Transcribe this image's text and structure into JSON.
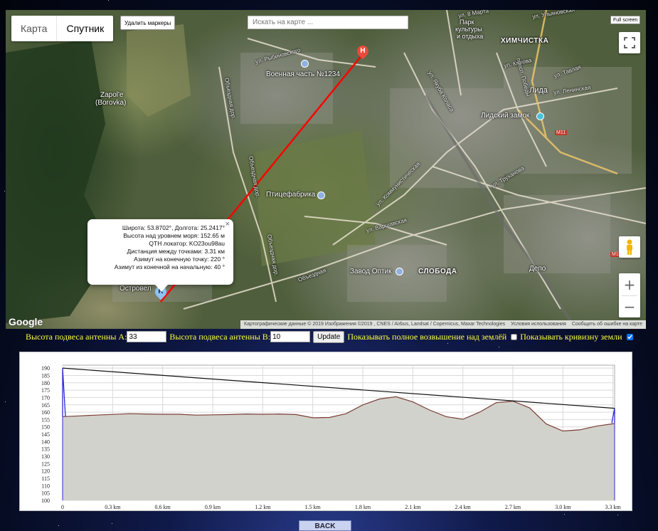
{
  "map": {
    "type_toggle": {
      "map_label": "Карта",
      "satellite_label": "Спутник",
      "selected": "Спутник"
    },
    "remove_markers_label": "Удалить маркеры",
    "search_placeholder": "Искать на карте ...",
    "fullscreen_label": "Full screen",
    "labels": {
      "military": "Военная часть №1234",
      "zapolle": "Zapol'e",
      "borovka": "(Borovka)",
      "khimchistka": "ХИМЧИСТКА",
      "park1": "Парк",
      "park2": "культуры",
      "park3": "и отдыха",
      "lida": "Лида",
      "castle": "Лидский замок",
      "poultry": "Птицефабрика",
      "optic": "Завод Оптик",
      "sloboda": "СЛОБОДА",
      "depot": "Депо",
      "ostrovel": "Островел",
      "st_rybinovskogo": "ул. Рыбиновского",
      "st_kirova": "ул. Кирова",
      "st_leninskaya": "ул. Ленинская",
      "st_tavlaya": "ул. Тавлая",
      "st_varshavskaya": "ул. Варшавская",
      "st_kommunisticheskaya": "ул. Коммунистическая",
      "st_truhanova": "ул. Труханова",
      "st_yakuba_kolasa": "ул. Якуба Коласа",
      "road_obezdnaya1": "Объездная дор.",
      "road_obezdnaya2": "Объездная",
      "pr_pobedy": "просп. Победы",
      "m11": "M11",
      "st_marta": "ул. 8 Марта",
      "st_ulyanovskaya": "ул. Ульяновская"
    },
    "markers": {
      "a": "K",
      "b": "H"
    },
    "google_label": "Google",
    "attribution": "Картографические данные © 2019 Изображения ©2019 , CNES / Airbus, Landsat / Copernicus, Maxar Technologies",
    "terms": "Условия использования",
    "report": "Сообщить об ошибке на карте",
    "infowindow": {
      "close": "×",
      "lines": [
        "Широта: 53.8702°, Долгота: 25.2417°",
        "Высота над уровнем моря: 152.65 м",
        "QTH локатор: KO23ou98au",
        "Дистанция между точками: 3.31 км",
        "Азимут на конечную точку: 220 °",
        "Азимут из конечной на начальную: 40 °"
      ]
    }
  },
  "controls": {
    "antenna_a_label": "Высота подвеса антенны A:",
    "antenna_a_value": "33",
    "antenna_b_label": "Высота подвеса антенны B:",
    "antenna_b_value": "10",
    "update_label": "Update",
    "full_elevation_label": "Показывать полное возвышение над землёй",
    "full_elevation_checked": false,
    "curvature_label": "Показывать кривизну земли",
    "curvature_checked": true
  },
  "back_label": "BACK",
  "chart_data": {
    "type": "area",
    "title": "",
    "xlabel": "",
    "ylabel": "",
    "xlim": [
      0,
      3.31
    ],
    "ylim": [
      100,
      192
    ],
    "x_ticks": [
      0,
      0.3,
      0.6,
      0.9,
      1.2,
      1.5,
      1.8,
      2.1,
      2.4,
      2.7,
      3.0,
      3.3
    ],
    "x_tick_labels": [
      "0",
      "0.3 km",
      "0.6 km",
      "0.9 km",
      "1.2 km",
      "1.5 km",
      "1.8 km",
      "2.1 km",
      "2.4 km",
      "2.7 km",
      "3.0 km",
      "3.3 km"
    ],
    "y_ticks": [
      100,
      105,
      110,
      115,
      120,
      125,
      130,
      135,
      140,
      145,
      150,
      155,
      160,
      165,
      170,
      175,
      180,
      185,
      190
    ],
    "terrain": {
      "x": [
        0,
        0.1,
        0.2,
        0.3,
        0.4,
        0.5,
        0.6,
        0.7,
        0.8,
        0.9,
        1.0,
        1.1,
        1.2,
        1.3,
        1.4,
        1.5,
        1.6,
        1.7,
        1.8,
        1.9,
        2.0,
        2.1,
        2.2,
        2.3,
        2.4,
        2.5,
        2.6,
        2.7,
        2.8,
        2.9,
        3.0,
        3.1,
        3.2,
        3.31
      ],
      "y": [
        157,
        157.5,
        158,
        158.5,
        159,
        158.8,
        158.6,
        158.6,
        158,
        158.2,
        158.4,
        158.8,
        158.6,
        158.8,
        158.4,
        156.2,
        156.4,
        159,
        165,
        169,
        170.5,
        167,
        161.5,
        157,
        155.2,
        160,
        166.5,
        167.5,
        163,
        152,
        147.2,
        148,
        150.5,
        152.3
      ]
    },
    "antenna_a": {
      "x": 0,
      "ground": 157,
      "top": 190
    },
    "antenna_b": {
      "x": 3.31,
      "ground": 152.65,
      "top": 162.65
    },
    "los_line": {
      "from": 190,
      "to": 162.65
    }
  }
}
